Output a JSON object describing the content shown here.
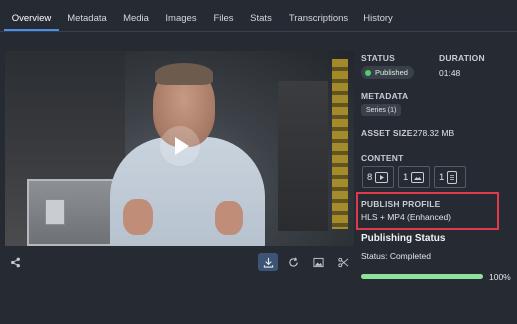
{
  "tabs": [
    {
      "label": "Overview",
      "active": true
    },
    {
      "label": "Metadata"
    },
    {
      "label": "Media"
    },
    {
      "label": "Images"
    },
    {
      "label": "Files"
    },
    {
      "label": "Stats"
    },
    {
      "label": "Transcriptions"
    },
    {
      "label": "History"
    }
  ],
  "status": {
    "label": "STATUS",
    "value": "Published",
    "color": "#4cd06a"
  },
  "duration": {
    "label": "DURATION",
    "value": "01:48"
  },
  "metadata": {
    "label": "METADATA",
    "badge": "Series (1)"
  },
  "asset_size": {
    "label": "ASSET SIZE",
    "value": "278.32 MB"
  },
  "content": {
    "label": "CONTENT",
    "items": [
      {
        "count": "8",
        "icon": "video-icon"
      },
      {
        "count": "1",
        "icon": "image-icon"
      },
      {
        "count": "1",
        "icon": "document-icon"
      }
    ]
  },
  "publish_profile": {
    "label": "PUBLISH PROFILE",
    "value": "HLS + MP4 (Enhanced)",
    "highlight_color": "#e03a4a"
  },
  "publishing_status": {
    "title": "Publishing Status",
    "status_text": "Status: Completed",
    "progress_percent": 100,
    "progress_label": "100%"
  },
  "toolbar": {
    "icons": [
      "share-icon",
      "download-icon",
      "refresh-icon",
      "image-icon",
      "scissors-icon"
    ]
  },
  "colors": {
    "accent": "#4a8fe7",
    "progress": "#8fe29a",
    "background": "#262a33"
  }
}
